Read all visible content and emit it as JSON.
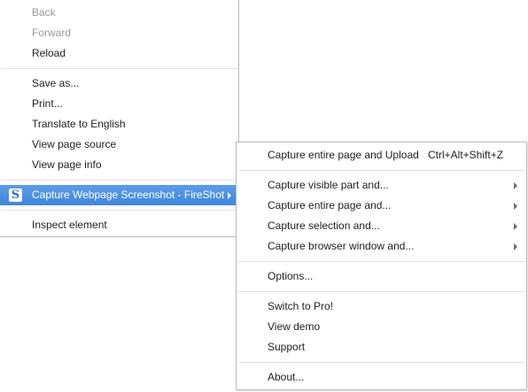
{
  "main_menu": {
    "back": "Back",
    "forward": "Forward",
    "reload": "Reload",
    "save_as": "Save as...",
    "print": "Print...",
    "translate": "Translate to English",
    "view_source": "View page source",
    "view_info": "View page info",
    "fireshot": "Capture Webpage Screenshot - FireShot",
    "fireshot_icon_glyph": "S",
    "inspect": "Inspect element"
  },
  "sub_menu": {
    "capture_upload": "Capture entire page and Upload",
    "capture_upload_shortcut": "Ctrl+Alt+Shift+Z",
    "capture_visible": "Capture visible part and...",
    "capture_entire": "Capture entire page and...",
    "capture_selection": "Capture selection and...",
    "capture_window": "Capture browser window and...",
    "options": "Options...",
    "switch_pro": "Switch to Pro!",
    "view_demo": "View demo",
    "support": "Support",
    "about": "About..."
  },
  "colors": {
    "highlight": "#4a90e2",
    "disabled_text": "#9a9a9a",
    "fireshot_icon": "#2a6fc9"
  },
  "icons": {
    "fireshot": "fireshot-logo-icon",
    "submenu": "chevron-right-icon"
  }
}
